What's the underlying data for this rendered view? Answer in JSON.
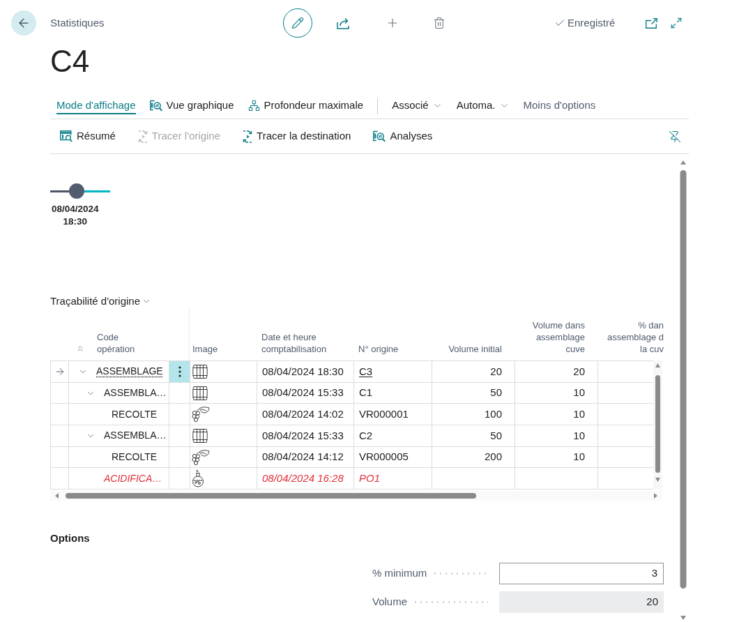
{
  "header": {
    "breadcrumb": "Statistiques",
    "title": "C4",
    "status": "Enregistré"
  },
  "action_bar": {
    "primary": [
      {
        "label": "Mode d'affichage",
        "kind": "tab",
        "selected": true
      },
      {
        "label": "Vue graphique",
        "kind": "action",
        "selected": false
      },
      {
        "label": "Profondeur maximale",
        "kind": "action",
        "selected": false
      },
      {
        "label": "Associé",
        "kind": "menu",
        "selected": false
      },
      {
        "label": "Automa.",
        "kind": "menu",
        "selected": false
      },
      {
        "label": "Moins d'options",
        "kind": "link",
        "selected": false
      }
    ],
    "secondary": [
      {
        "label": "Résumé",
        "disabled": false
      },
      {
        "label": "Tracer l'origine",
        "disabled": true
      },
      {
        "label": "Tracer la destination",
        "disabled": false
      },
      {
        "label": "Analyses",
        "disabled": false
      }
    ]
  },
  "timeline": {
    "level": 0.44,
    "date": "08/04/2024",
    "time": "18:30"
  },
  "traceability": {
    "title": "Traçabilité d'origine",
    "columns": [
      "Code\nopération",
      "Image",
      "Date et heure\ncomptabilisation",
      "N° origine",
      "Volume initial",
      "Volume dans\nassemblage\ncuve",
      "% dan\nassemblage d\nla cuv"
    ],
    "rows": [
      {
        "code": "ASSEMBLAGE",
        "kind": "blend",
        "date": "08/04/2024 18:30",
        "origin": "C3",
        "volume_initial": "20",
        "volume_in_blend": "20",
        "current": true,
        "alert": false,
        "expanded": true,
        "children": [
          {
            "code": "ASSEMBLA…",
            "kind": "blend",
            "date": "08/04/2024 15:33",
            "origin": "C1",
            "volume_initial": "50",
            "volume_in_blend": "10",
            "current": false,
            "alert": false,
            "expanded": true,
            "children": [
              {
                "code": "RECOLTE",
                "kind": "harvest",
                "date": "08/04/2024 14:02",
                "origin": "VR000001",
                "volume_initial": "100",
                "volume_in_blend": "10",
                "current": false,
                "alert": false
              }
            ]
          },
          {
            "code": "ASSEMBLA…",
            "kind": "blend",
            "date": "08/04/2024 15:33",
            "origin": "C2",
            "volume_initial": "50",
            "volume_in_blend": "10",
            "current": false,
            "alert": false,
            "expanded": true,
            "children": [
              {
                "code": "RECOLTE",
                "kind": "harvest",
                "date": "08/04/2024 14:12",
                "origin": "VR000005",
                "volume_initial": "200",
                "volume_in_blend": "10",
                "current": false,
                "alert": false
              }
            ]
          },
          {
            "code": "ACIDIFICA…",
            "kind": "treatment",
            "date": "08/04/2024 16:28",
            "origin": "PO1",
            "current": false,
            "alert": true
          }
        ]
      }
    ]
  },
  "options": {
    "title": "Options",
    "fields": [
      {
        "label": "% minimum",
        "value": "3",
        "readonly": false
      },
      {
        "label": "Volume",
        "value": "20",
        "readonly": true
      }
    ]
  }
}
